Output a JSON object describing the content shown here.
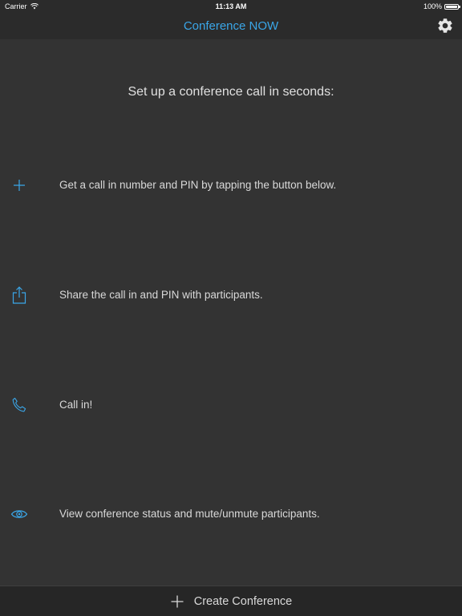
{
  "status_bar": {
    "carrier": "Carrier",
    "time": "11:13 AM",
    "battery": "100%",
    "wifi_icon": "wifi-icon",
    "battery_icon": "battery-icon"
  },
  "nav": {
    "title": "Conference NOW",
    "settings_icon": "gear-icon"
  },
  "main": {
    "headline": "Set up a conference call in seconds:",
    "steps": [
      {
        "icon": "plus-icon",
        "text": "Get a call in number and PIN by tapping the button below."
      },
      {
        "icon": "share-icon",
        "text": "Share the call in and PIN with participants."
      },
      {
        "icon": "phone-icon",
        "text": "Call in!"
      },
      {
        "icon": "eye-icon",
        "text": "View conference status and mute/unmute participants."
      }
    ]
  },
  "bottom_bar": {
    "label": "Create Conference",
    "icon": "plus-icon"
  },
  "colors": {
    "accent": "#3aa6e8",
    "background": "#333333",
    "bar_background": "#2b2b2b"
  }
}
